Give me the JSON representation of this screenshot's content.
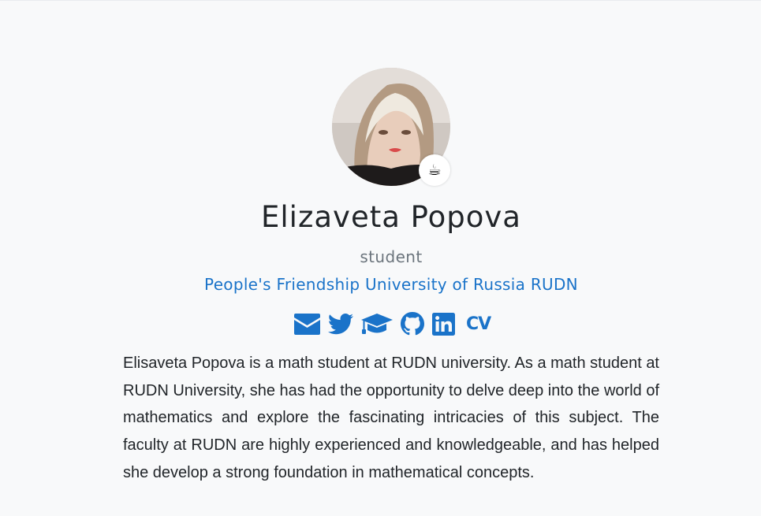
{
  "profile": {
    "name": "Elizaveta Popova",
    "role": "student",
    "organization": "People's Friendship University of Russia RUDN",
    "status_emoji": "☕",
    "avatar_alt": "avatar"
  },
  "social": {
    "cv_label": "CV",
    "icons": [
      "envelope-icon",
      "twitter-icon",
      "graduation-cap-icon",
      "github-icon",
      "linkedin-icon"
    ]
  },
  "bio": "Elisaveta Popova is a math student at RUDN university. As a math student at RUDN University, she has had the opportunity to delve deep into the world of mathematics and explore the fascinating intricacies of this subject. The faculty at RUDN are highly experienced and knowledgeable, and has helped she develop a strong foundation in mathematical concepts.",
  "colors": {
    "accent": "#1a73c9",
    "text": "#212529",
    "muted": "#6c757d",
    "background": "#f8f9fa"
  }
}
